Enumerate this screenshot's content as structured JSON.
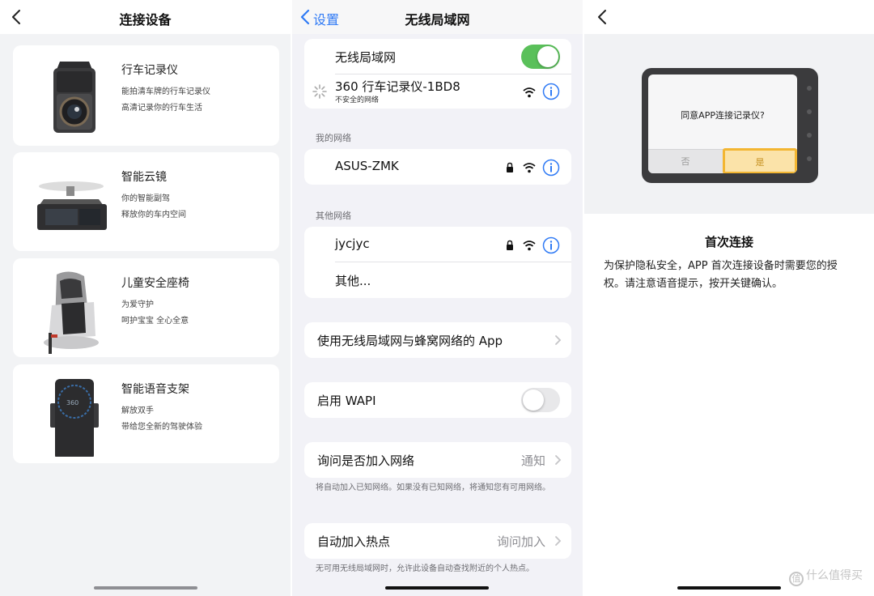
{
  "colors": {
    "ios_blue": "#2f7af5",
    "toggle_on": "#5ac05a",
    "toggle_off": "#e8e8ea",
    "confirm_yellow": "#f3b632"
  },
  "left_panel": {
    "title": "连接设备",
    "devices": [
      {
        "name": "行车记录仪",
        "line1": "能拍清车牌的行车记录仪",
        "line2": "高清记录你的行车生活",
        "icon": "dashcam-icon"
      },
      {
        "name": "智能云镜",
        "line1": "你的智能副驾",
        "line2": "释放你的车内空间",
        "icon": "smart-mirror-icon"
      },
      {
        "name": "儿童安全座椅",
        "line1": "为爱守护",
        "line2": "呵护宝宝 全心全意",
        "icon": "child-seat-icon"
      },
      {
        "name": "智能语音支架",
        "line1": "解放双手",
        "line2": "带给您全新的驾驶体验",
        "icon": "phone-holder-icon"
      }
    ]
  },
  "middle_panel": {
    "back_label": "设置",
    "title": "无线局域网",
    "wifi_label": "无线局域网",
    "wifi_enabled": true,
    "connected": {
      "name": "360 行车记录仪-1BD8",
      "subtitle": "不安全的网络"
    },
    "my_networks_header": "我的网络",
    "my_networks": [
      {
        "name": "ASUS-ZMK"
      }
    ],
    "other_networks_header": "其他网络",
    "other_networks": [
      {
        "name": "jycjyc"
      }
    ],
    "other_label": "其他...",
    "apps_row": "使用无线局域网与蜂窝网络的 App",
    "wapi_label": "启用 WAPI",
    "wapi_enabled": false,
    "ask_join": {
      "label": "询问是否加入网络",
      "value": "通知"
    },
    "ask_join_footer": "将自动加入已知网络。如果没有已知网络，将通知您有可用网络。",
    "hotspot": {
      "label": "自动加入热点",
      "value": "询问加入"
    },
    "hotspot_footer": "无可用无线局域网时，允许此设备自动查找附近的个人热点。"
  },
  "right_panel": {
    "dialog_question": "同意APP连接记录仪?",
    "no_label": "否",
    "yes_label": "是",
    "heading": "首次连接",
    "body": "为保护隐私安全，APP 首次连接设备时需要您的授权。请注意语音提示，按开关键确认。",
    "watermark_icon": "值",
    "watermark_text": "什么值得买"
  }
}
